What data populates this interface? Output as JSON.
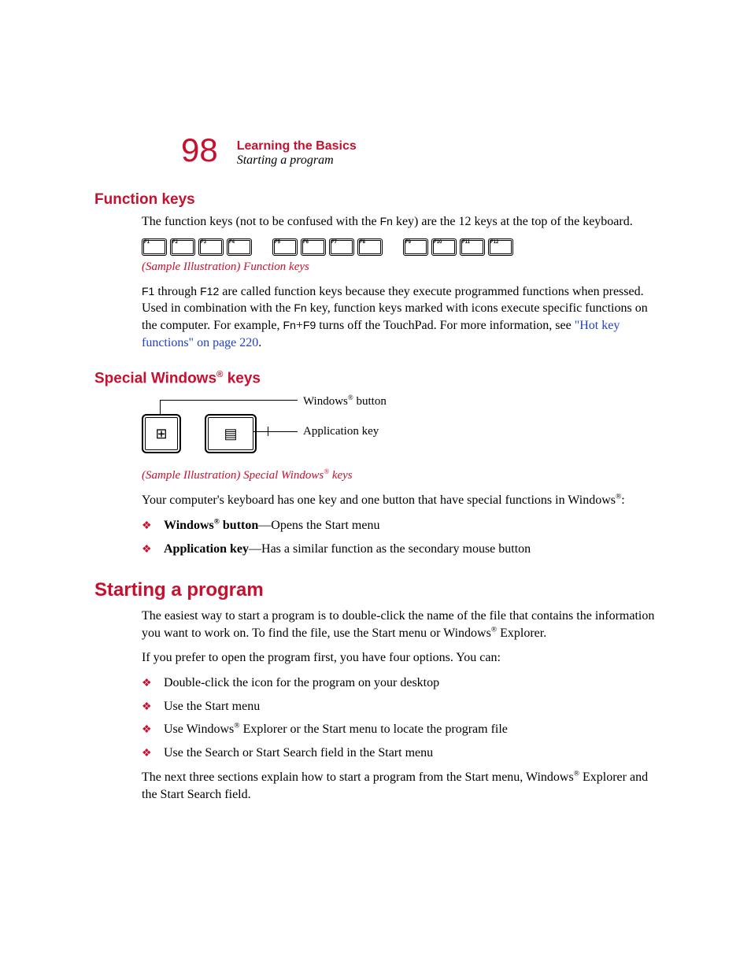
{
  "header": {
    "page_number": "98",
    "chapter": "Learning the Basics",
    "section": "Starting a program"
  },
  "section1": {
    "heading": "Function keys",
    "p1_a": "The function keys (not to be confused with the ",
    "p1_fn": "Fn",
    "p1_b": " key) are the 12 keys at the top of the keyboard.",
    "caption": "(Sample Illustration) Function keys",
    "p2_a": "F1",
    "p2_b": " through ",
    "p2_c": "F12",
    "p2_d": " are called function keys because they execute programmed functions when pressed. Used in combination with the ",
    "p2_e": "Fn",
    "p2_f": " key, function keys marked with icons execute specific functions on the computer. For example, ",
    "p2_g": "Fn",
    "p2_h": "+",
    "p2_i": "F9",
    "p2_j": " turns off the TouchPad. For more information, see ",
    "p2_link": "\"Hot key functions\" on page 220",
    "p2_k": ".",
    "fkeys": [
      "F1",
      "F2",
      "F3",
      "F4",
      "F5",
      "F6",
      "F7",
      "F8",
      "F9",
      "F10",
      "F11",
      "F12"
    ]
  },
  "section2": {
    "heading_a": "Special Windows",
    "heading_b": " keys",
    "label_win_a": "Windows",
    "label_win_b": " button",
    "label_app": "Application key",
    "caption_a": "(Sample Illustration) Special Windows",
    "caption_b": " keys",
    "p1_a": "Your computer's keyboard has one key and one button that have special functions in Windows",
    "p1_b": ":",
    "bullets": [
      {
        "bold_a": "Windows",
        "bold_b": " button",
        "rest": "—Opens the Start menu"
      },
      {
        "bold_a": "Application key",
        "bold_b": "",
        "rest": "—Has a similar function as the secondary mouse button"
      }
    ]
  },
  "section3": {
    "heading": "Starting a program",
    "p1_a": "The easiest way to start a program is to double-click the name of the file that contains the information you want to work on. To find the file, use the Start menu or Windows",
    "p1_b": " Explorer.",
    "p2": "If you prefer to open the program first, you have four options. You can:",
    "bullets": [
      "Double-click the icon for the program on your desktop",
      "Use the Start menu",
      "Use Windows® Explorer or the Start menu to locate the program file",
      "Use the Search or Start Search field in the Start menu"
    ],
    "b3_a": "Use Windows",
    "b3_b": " Explorer or the Start menu to locate the program file",
    "p3_a": "The next three sections explain how to start a program from the Start menu, Windows",
    "p3_b": " Explorer and the Start Search field."
  }
}
